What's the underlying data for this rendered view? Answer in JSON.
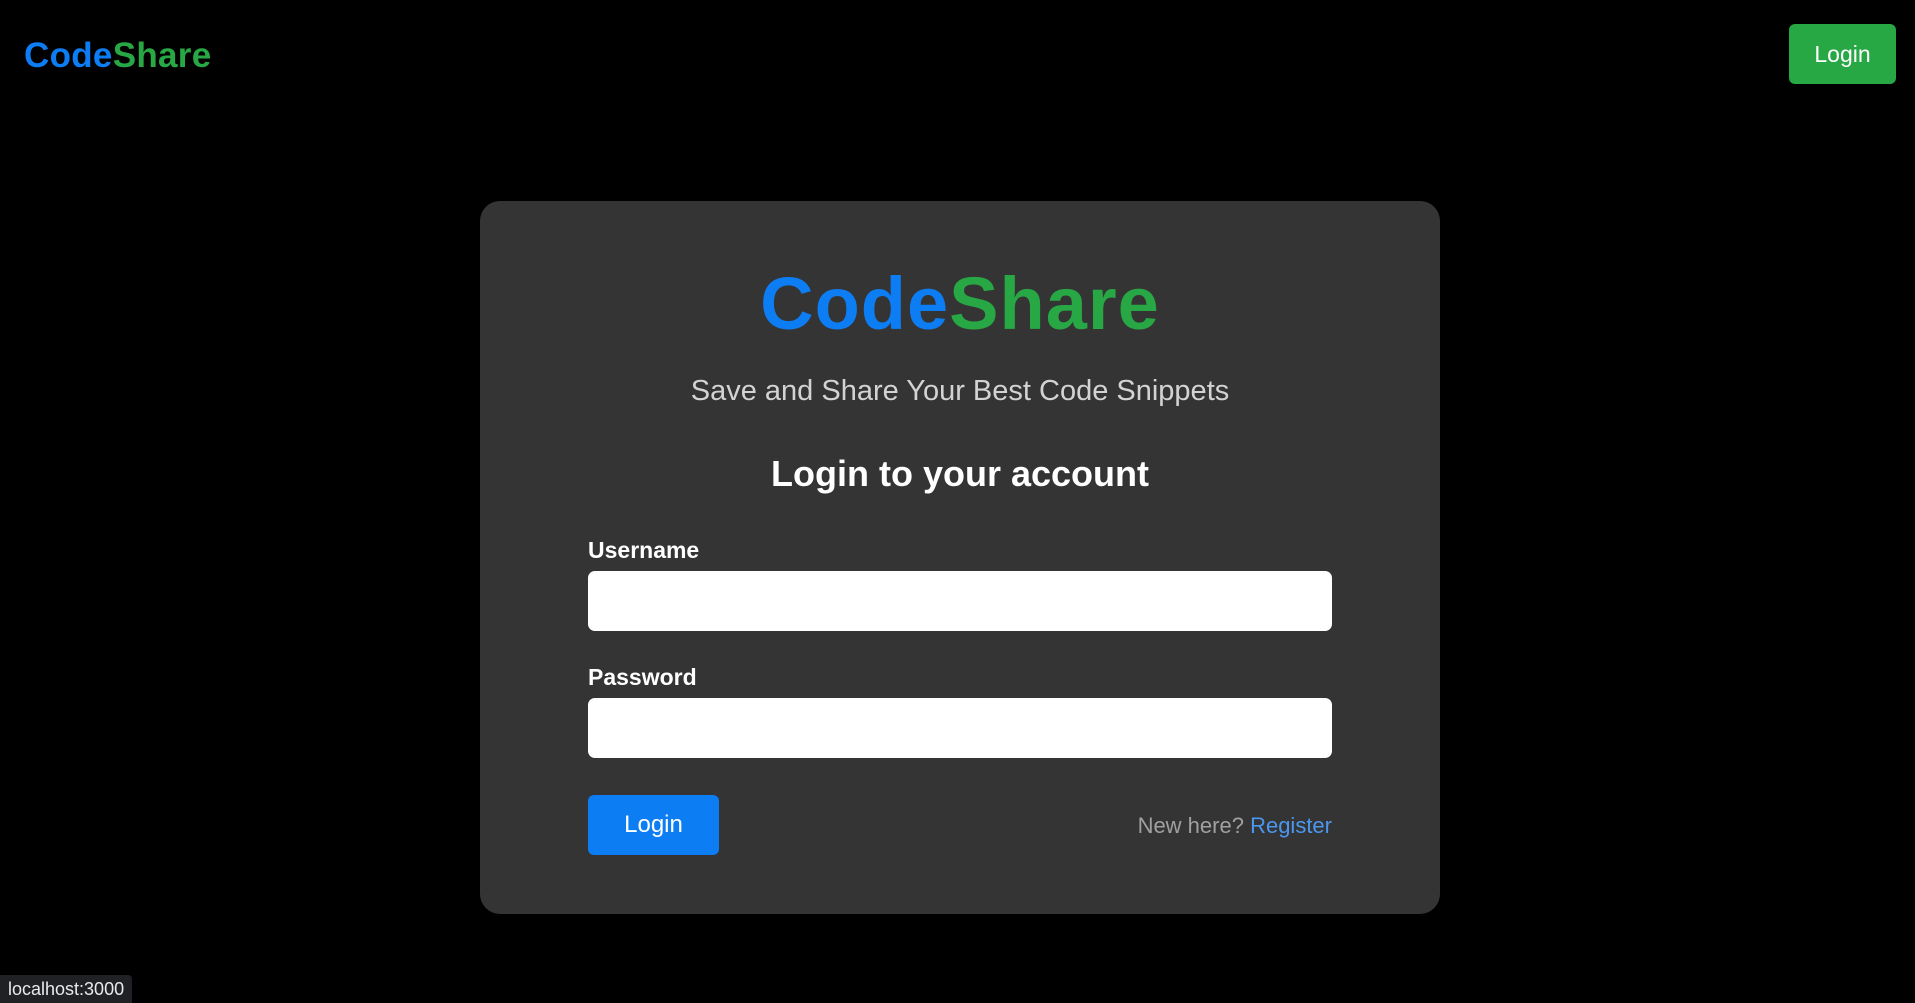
{
  "nav": {
    "brand_part1": "Code",
    "brand_part2": "Share",
    "login_label": "Login"
  },
  "card": {
    "brand_part1": "Code",
    "brand_part2": "Share",
    "tagline": "Save and Share Your Best Code Snippets",
    "heading": "Login to your account",
    "username_label": "Username",
    "username_value": "",
    "password_label": "Password",
    "password_value": "",
    "submit_label": "Login",
    "register_prompt": "New here?",
    "register_link": "Register"
  },
  "status_bar": {
    "url": "localhost:3000"
  },
  "colors": {
    "background": "#000000",
    "card": "#343434",
    "brand_blue": "#0d7df4",
    "brand_green": "#28a745",
    "link": "#4b96ee"
  }
}
